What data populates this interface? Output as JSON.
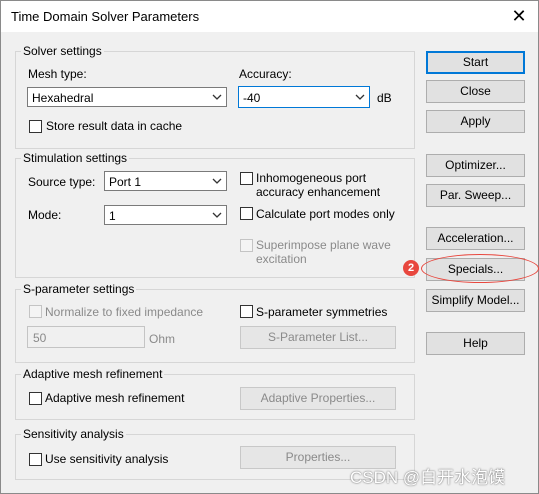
{
  "window": {
    "title": "Time Domain Solver Parameters",
    "close_glyph": "✕"
  },
  "solver": {
    "group_label": "Solver settings",
    "mesh_type_label": "Mesh type:",
    "mesh_type_value": "Hexahedral",
    "accuracy_label": "Accuracy:",
    "accuracy_value": "-40",
    "accuracy_unit": "dB",
    "store_label": "Store result data in cache"
  },
  "stimulation": {
    "group_label": "Stimulation settings",
    "source_type_label": "Source type:",
    "source_type_value": "Port 1",
    "mode_label": "Mode:",
    "mode_value": "1",
    "inhomogeneous_label_1": "Inhomogeneous port",
    "inhomogeneous_label_2": "accuracy enhancement",
    "calc_modes_label": "Calculate port modes only",
    "superimpose_label_1": "Superimpose plane wave",
    "superimpose_label_2": "excitation"
  },
  "sparam": {
    "group_label": "S-parameter settings",
    "normalize_label": "Normalize to fixed impedance",
    "impedance_value": "50",
    "impedance_unit": "Ohm",
    "symmetries_label": "S-parameter symmetries",
    "list_button": "S-Parameter List..."
  },
  "adaptive": {
    "group_label": "Adaptive mesh refinement",
    "check_label": "Adaptive mesh refinement",
    "properties_button": "Adaptive Properties..."
  },
  "sensitivity": {
    "group_label": "Sensitivity analysis",
    "check_label": "Use sensitivity analysis",
    "properties_button": "Properties..."
  },
  "buttons": {
    "start": "Start",
    "close": "Close",
    "apply": "Apply",
    "optimizer": "Optimizer...",
    "par_sweep": "Par. Sweep...",
    "acceleration": "Acceleration...",
    "specials": "Specials...",
    "simplify_model": "Simplify Model...",
    "help": "Help"
  },
  "annotation": {
    "badge_number": "2",
    "color": "#e8473e"
  },
  "watermark": "CSDN @白开水泡馍"
}
